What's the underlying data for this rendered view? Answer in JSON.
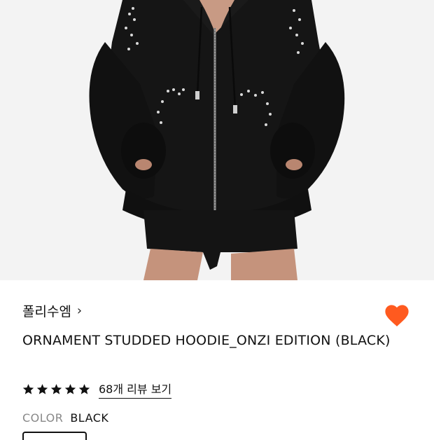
{
  "product": {
    "brand": "폴리수엠",
    "brand_chevron": "›",
    "title": "ORNAMENT STUDDED HOODIE_ONZI EDITION (BLACK)",
    "rating": 5,
    "rating_max": 5,
    "review_link": "68개 리뷰 보기",
    "color_label": "COLOR",
    "color_value": "BLACK",
    "favorited": true
  },
  "colors": {
    "heart": "#ff5a1f",
    "star": "#111111",
    "hoodie": "#151515",
    "background": "#f4f4f4"
  },
  "icons": {
    "heart": "heart-icon",
    "star": "star-icon",
    "chevron": "chevron-right-icon"
  }
}
